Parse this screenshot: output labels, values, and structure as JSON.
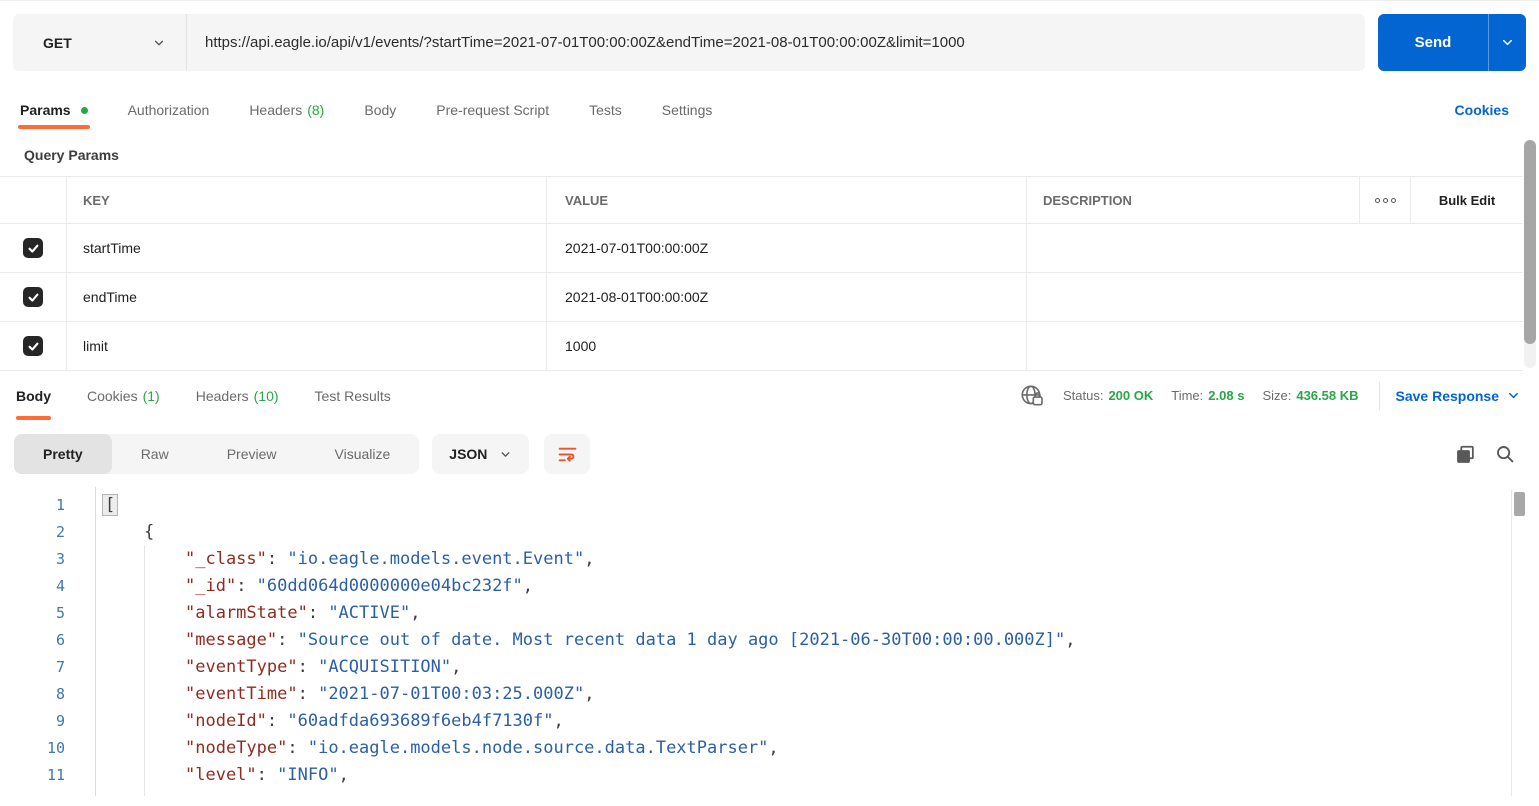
{
  "colors": {
    "accent_orange": "#ff6c37",
    "primary_blue": "#0265d2",
    "success_green": "#29a746",
    "json_key": "#8f2c20",
    "json_string": "#2b5fa6",
    "line_number": "#3e78ad"
  },
  "request": {
    "method": "GET",
    "url": "https://api.eagle.io/api/v1/events/?startTime=2021-07-01T00:00:00Z&endTime=2021-08-01T00:00:00Z&limit=1000",
    "send_label": "Send",
    "cookies_link": "Cookies",
    "tabs": [
      {
        "label": "Params"
      },
      {
        "label": "Authorization"
      },
      {
        "label": "Headers",
        "count": "(8)"
      },
      {
        "label": "Body"
      },
      {
        "label": "Pre-request Script"
      },
      {
        "label": "Tests"
      },
      {
        "label": "Settings"
      }
    ]
  },
  "params": {
    "title": "Query Params",
    "columns": {
      "key": "KEY",
      "value": "VALUE",
      "description": "DESCRIPTION"
    },
    "bulk_edit": "Bulk Edit",
    "rows": [
      {
        "checked": true,
        "key": "startTime",
        "value": "2021-07-01T00:00:00Z",
        "description": ""
      },
      {
        "checked": true,
        "key": "endTime",
        "value": "2021-08-01T00:00:00Z",
        "description": ""
      },
      {
        "checked": true,
        "key": "limit",
        "value": "1000",
        "description": ""
      }
    ]
  },
  "response": {
    "tabs": [
      {
        "label": "Body"
      },
      {
        "label": "Cookies",
        "count": "(1)"
      },
      {
        "label": "Headers",
        "count": "(10)"
      },
      {
        "label": "Test Results"
      }
    ],
    "status_label": "Status:",
    "status_value": "200 OK",
    "time_label": "Time:",
    "time_value": "2.08 s",
    "size_label": "Size:",
    "size_value": "436.58 KB",
    "save_label": "Save Response",
    "views": [
      "Pretty",
      "Raw",
      "Preview",
      "Visualize"
    ],
    "active_view": "Pretty",
    "format": "JSON"
  },
  "code": {
    "lines": [
      {
        "n": "1",
        "open": "["
      },
      {
        "n": "2",
        "open": "{"
      },
      {
        "n": "3",
        "key": "\"_class\"",
        "sep": ": ",
        "val": "\"io.eagle.models.event.Event\"",
        "end": ","
      },
      {
        "n": "4",
        "key": "\"_id\"",
        "sep": ": ",
        "val": "\"60dd064d0000000e04bc232f\"",
        "end": ","
      },
      {
        "n": "5",
        "key": "\"alarmState\"",
        "sep": ": ",
        "val": "\"ACTIVE\"",
        "end": ","
      },
      {
        "n": "6",
        "key": "\"message\"",
        "sep": ": ",
        "val": "\"Source out of date. Most recent data 1 day ago [2021-06-30T00:00:00.000Z]\"",
        "end": ","
      },
      {
        "n": "7",
        "key": "\"eventType\"",
        "sep": ": ",
        "val": "\"ACQUISITION\"",
        "end": ","
      },
      {
        "n": "8",
        "key": "\"eventTime\"",
        "sep": ": ",
        "val": "\"2021-07-01T00:03:25.000Z\"",
        "end": ","
      },
      {
        "n": "9",
        "key": "\"nodeId\"",
        "sep": ": ",
        "val": "\"60adfda693689f6eb4f7130f\"",
        "end": ","
      },
      {
        "n": "10",
        "key": "\"nodeType\"",
        "sep": ": ",
        "val": "\"io.eagle.models.node.source.data.TextParser\"",
        "end": ","
      },
      {
        "n": "11",
        "key": "\"level\"",
        "sep": ": ",
        "val": "\"INFO\"",
        "end": ","
      }
    ]
  }
}
